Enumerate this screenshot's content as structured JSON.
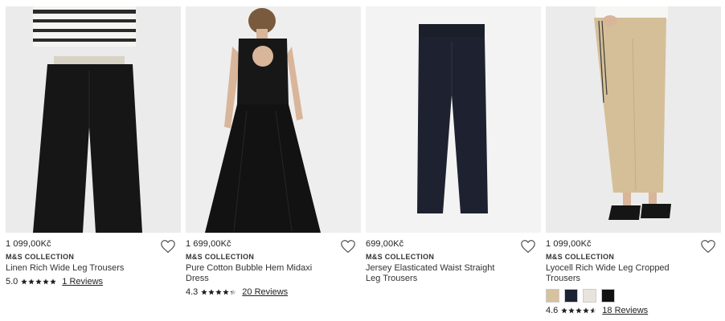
{
  "products": [
    {
      "price": "1 099,00Kč",
      "brand": "M&S COLLECTION",
      "name": "Linen Rich Wide Leg Trousers",
      "score": "5.0",
      "stars": 5,
      "reviews": "1 Reviews"
    },
    {
      "price": "1 699,00Kč",
      "brand": "M&S COLLECTION",
      "name": "Pure Cotton Bubble Hem Midaxi Dress",
      "score": "4.3",
      "stars": 4.3,
      "reviews": "20 Reviews"
    },
    {
      "price": "699,00Kč",
      "brand": "M&S COLLECTION",
      "name": "Jersey Elasticated Waist Straight Leg Trousers",
      "score": "",
      "stars": 0,
      "reviews": ""
    },
    {
      "price": "1 099,00Kč",
      "brand": "M&S COLLECTION",
      "name": "Lyocell Rich Wide Leg Cropped Trousers",
      "score": "4.6",
      "stars": 4.6,
      "reviews": "18 Reviews",
      "swatches": [
        "#d6c29e",
        "#1c2333",
        "#e8e4dc",
        "#111111"
      ]
    }
  ],
  "icons": {
    "wishlist": "heart-outline-icon",
    "rating": "star-icon"
  }
}
